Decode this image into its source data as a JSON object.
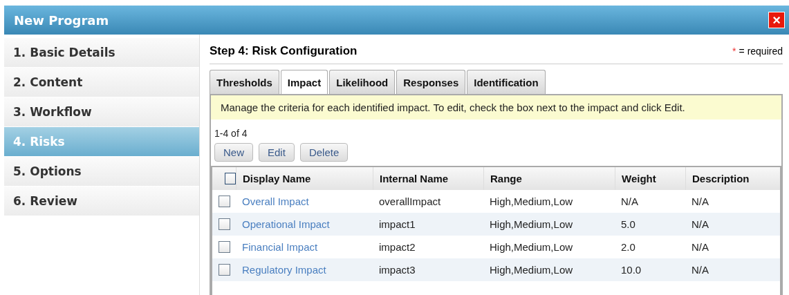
{
  "window": {
    "title": "New Program",
    "close": "×"
  },
  "steps": [
    {
      "label": "1. Basic Details",
      "selected": false
    },
    {
      "label": "2. Content",
      "selected": false
    },
    {
      "label": "3. Workflow",
      "selected": false
    },
    {
      "label": "4. Risks",
      "selected": true
    },
    {
      "label": "5. Options",
      "selected": false
    },
    {
      "label": "6. Review",
      "selected": false
    }
  ],
  "heading": "Step 4: Risk Configuration",
  "required_note": {
    "mark": "*",
    "label": "= required"
  },
  "tabs": [
    {
      "label": "Thresholds",
      "selected": false
    },
    {
      "label": "Impact",
      "selected": true
    },
    {
      "label": "Likelihood",
      "selected": false
    },
    {
      "label": "Responses",
      "selected": false
    },
    {
      "label": "Identification",
      "selected": false
    }
  ],
  "info": "Manage the criteria for each identified impact. To edit, check the box next to the impact and click Edit.",
  "count": "1-4 of 4",
  "buttons": [
    "New",
    "Edit",
    "Delete"
  ],
  "table": {
    "select_all_checked": false,
    "columns": [
      "Display Name",
      "Internal Name",
      "Range",
      "Weight",
      "Description"
    ],
    "rows": [
      {
        "checked": false,
        "cells": [
          "Overall Impact",
          "overallImpact",
          "High,Medium,Low",
          "N/A",
          "N/A"
        ]
      },
      {
        "checked": false,
        "cells": [
          "Operational Impact",
          "impact1",
          "High,Medium,Low",
          "5.0",
          "N/A"
        ]
      },
      {
        "checked": false,
        "cells": [
          "Financial Impact",
          "impact2",
          "High,Medium,Low",
          "2.0",
          "N/A"
        ]
      },
      {
        "checked": false,
        "cells": [
          "Regulatory Impact",
          "impact3",
          "High,Medium,Low",
          "10.0",
          "N/A"
        ]
      }
    ]
  }
}
